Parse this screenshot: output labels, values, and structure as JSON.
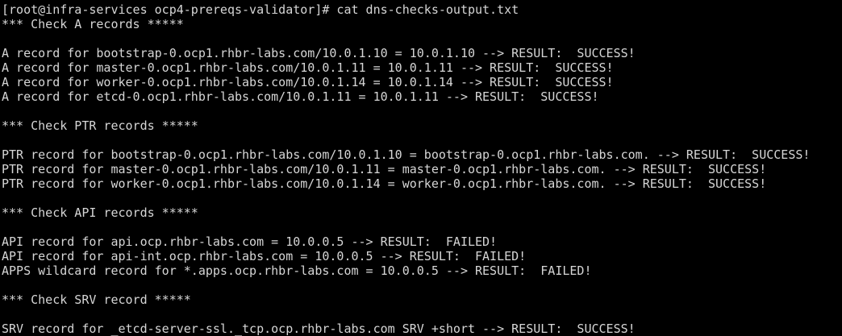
{
  "terminal": {
    "prompt": "[root@infra-services ocp4-prereqs-validator]# cat dns-checks-output.txt",
    "lines": [
      "*** Check A records *****",
      "",
      "A record for bootstrap-0.ocp1.rhbr-labs.com/10.0.1.10 = 10.0.1.10 --> RESULT:  SUCCESS!",
      "A record for master-0.ocp1.rhbr-labs.com/10.0.1.11 = 10.0.1.11 --> RESULT:  SUCCESS!",
      "A record for worker-0.ocp1.rhbr-labs.com/10.0.1.14 = 10.0.1.14 --> RESULT:  SUCCESS!",
      "A record for etcd-0.ocp1.rhbr-labs.com/10.0.1.11 = 10.0.1.11 --> RESULT:  SUCCESS!",
      "",
      "*** Check PTR records *****",
      "",
      "PTR record for bootstrap-0.ocp1.rhbr-labs.com/10.0.1.10 = bootstrap-0.ocp1.rhbr-labs.com. --> RESULT:  SUCCESS!",
      "PTR record for master-0.ocp1.rhbr-labs.com/10.0.1.11 = master-0.ocp1.rhbr-labs.com. --> RESULT:  SUCCESS!",
      "PTR record for worker-0.ocp1.rhbr-labs.com/10.0.1.14 = worker-0.ocp1.rhbr-labs.com. --> RESULT:  SUCCESS!",
      "",
      "*** Check API records *****",
      "",
      "API record for api.ocp.rhbr-labs.com = 10.0.0.5 --> RESULT:  FAILED!",
      "API record for api-int.ocp.rhbr-labs.com = 10.0.0.5 --> RESULT:  FAILED!",
      "APPS wildcard record for *.apps.ocp.rhbr-labs.com = 10.0.0.5 --> RESULT:  FAILED!",
      "",
      "*** Check SRV record *****",
      "",
      "SRV record for _etcd-server-ssl._tcp.ocp.rhbr-labs.com SRV +short --> RESULT:  SUCCESS!"
    ]
  },
  "colors": {
    "background": "#000000",
    "foreground": "#d6d6d6"
  }
}
